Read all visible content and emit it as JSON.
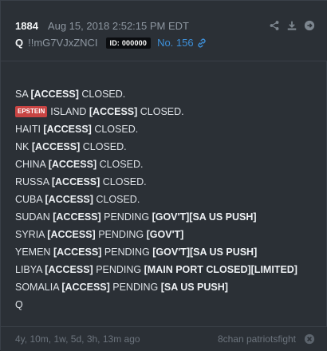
{
  "post": {
    "number": "1884",
    "timestamp": "Aug 15, 2018 2:52:15 PM EDT",
    "author": "Q",
    "tripcode": "!!mG7VJxZNCI",
    "id_badge": "ID: 000000",
    "post_link": "No. 156"
  },
  "icons": {
    "share": "share-icon",
    "download": "download-icon",
    "goto": "arrow-right-circle-icon",
    "link": "link-icon",
    "close": "close-circle-icon"
  },
  "colors": {
    "background": "#2b3036",
    "link": "#3d8fd8",
    "tag_badge": "#c84443",
    "id_badge": "#0b0d10"
  },
  "lines": [
    [
      {
        "t": "SA ",
        "b": false
      },
      {
        "t": "[ACCESS]",
        "b": true
      },
      {
        "t": " CLOSED.",
        "b": false
      }
    ],
    [
      {
        "tag": "EPSTEIN"
      },
      {
        "t": "ISLAND ",
        "b": false
      },
      {
        "t": "[ACCESS]",
        "b": true
      },
      {
        "t": " CLOSED.",
        "b": false
      }
    ],
    [
      {
        "t": "HAITI ",
        "b": false
      },
      {
        "t": "[ACCESS]",
        "b": true
      },
      {
        "t": " CLOSED.",
        "b": false
      }
    ],
    [
      {
        "t": "NK ",
        "b": false
      },
      {
        "t": "[ACCESS]",
        "b": true
      },
      {
        "t": " CLOSED.",
        "b": false
      }
    ],
    [
      {
        "t": "CHINA ",
        "b": false
      },
      {
        "t": "[ACCESS]",
        "b": true
      },
      {
        "t": " CLOSED.",
        "b": false
      }
    ],
    [
      {
        "t": "RUSSA ",
        "b": false
      },
      {
        "t": "[ACCESS]",
        "b": true
      },
      {
        "t": " CLOSED.",
        "b": false
      }
    ],
    [
      {
        "t": "CUBA ",
        "b": false
      },
      {
        "t": "[ACCESS]",
        "b": true
      },
      {
        "t": " CLOSED.",
        "b": false
      }
    ],
    [
      {
        "t": "SUDAN ",
        "b": false
      },
      {
        "t": "[ACCESS]",
        "b": true
      },
      {
        "t": " PENDING ",
        "b": false
      },
      {
        "t": "[GOV'T][SA US PUSH]",
        "b": true
      }
    ],
    [
      {
        "t": "SYRIA ",
        "b": false
      },
      {
        "t": "[ACCESS]",
        "b": true
      },
      {
        "t": " PENDING ",
        "b": false
      },
      {
        "t": "[GOV'T]",
        "b": true
      }
    ],
    [
      {
        "t": "YEMEN ",
        "b": false
      },
      {
        "t": "[ACCESS]",
        "b": true
      },
      {
        "t": " PENDING ",
        "b": false
      },
      {
        "t": "[GOV'T][SA US PUSH]",
        "b": true
      }
    ],
    [
      {
        "t": "LIBYA ",
        "b": false
      },
      {
        "t": "[ACCESS]",
        "b": true
      },
      {
        "t": " PENDING ",
        "b": false
      },
      {
        "t": "[MAIN PORT CLOSED][LIMITED]",
        "b": true
      }
    ],
    [
      {
        "t": "SOMALIA ",
        "b": false
      },
      {
        "t": "[ACCESS]",
        "b": true
      },
      {
        "t": " PENDING ",
        "b": false
      },
      {
        "t": "[SA US PUSH]",
        "b": true
      }
    ],
    [
      {
        "t": "Q",
        "b": false
      }
    ]
  ],
  "footer": {
    "ago": "4y, 10m, 1w, 5d, 3h, 13m ago",
    "board": "8chan patriotsfight"
  }
}
